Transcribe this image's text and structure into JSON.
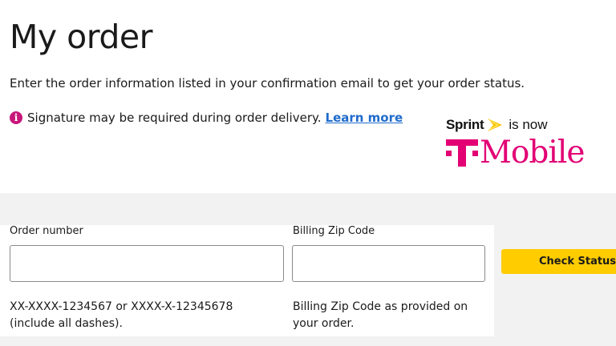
{
  "header": {
    "title": "My order",
    "intro": "Enter the order information listed in your confirmation email to get your order status."
  },
  "notice": {
    "icon": "info-icon",
    "icon_glyph": "i",
    "text": "Signature may be required during order delivery.",
    "link_label": "Learn more"
  },
  "brand": {
    "sprint": "Sprint",
    "is_now": "is now",
    "tmobile": "Mobile",
    "sprint_color": "#f7c600",
    "tmobile_color": "#e20074"
  },
  "form": {
    "order_label": "Order number",
    "order_value": "",
    "order_placeholder": "",
    "order_hint": "XX-XXXX-1234567 or XXXX-X-12345678 (include all dashes).",
    "zip_label": "Billing Zip Code",
    "zip_value": "",
    "zip_placeholder": "",
    "zip_hint": "Billing Zip Code as provided on your order.",
    "submit_label": "Check Status"
  },
  "colors": {
    "accent_button": "#ffcc00",
    "link": "#1f6bcc",
    "info_icon": "#c8177a",
    "band_background": "#f2f2f2"
  }
}
